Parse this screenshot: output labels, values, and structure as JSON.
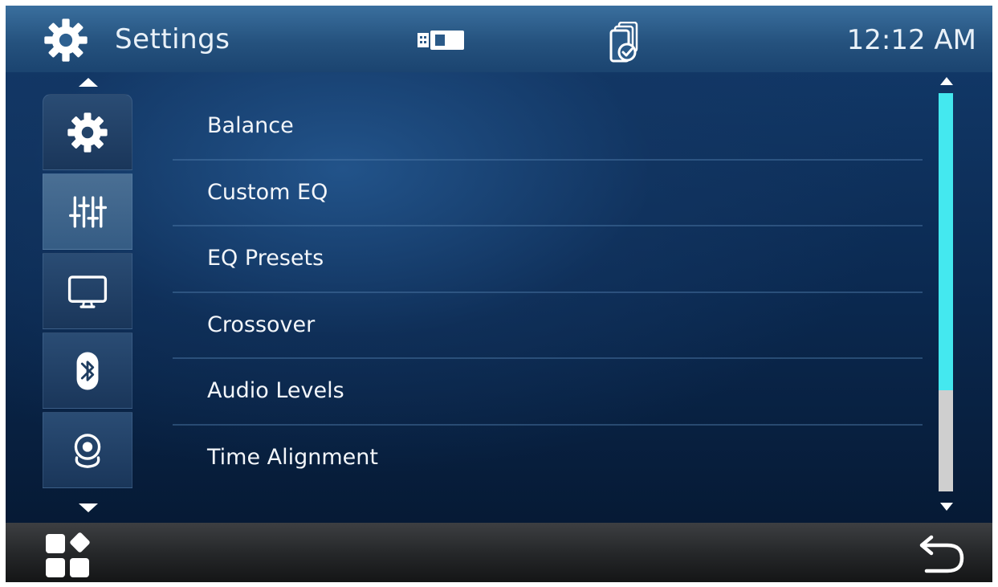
{
  "header": {
    "title": "Settings",
    "time": "12:12 AM",
    "icons": {
      "settings": "gear-icon",
      "storage": "usb-icon",
      "phone": "phone-connected-icon"
    }
  },
  "sidebar": {
    "items": [
      {
        "name": "general",
        "icon": "gear-icon",
        "active": false
      },
      {
        "name": "audio",
        "icon": "equalizer-sliders-icon",
        "active": true
      },
      {
        "name": "display",
        "icon": "monitor-icon",
        "active": false
      },
      {
        "name": "bluetooth",
        "icon": "bluetooth-icon",
        "active": false
      },
      {
        "name": "camera",
        "icon": "camera-icon",
        "active": false
      }
    ]
  },
  "menu": {
    "items": [
      {
        "label": "Balance"
      },
      {
        "label": "Custom EQ"
      },
      {
        "label": "EQ Presets"
      },
      {
        "label": "Crossover"
      },
      {
        "label": "Audio Levels"
      },
      {
        "label": "Time Alignment"
      }
    ]
  },
  "scrollbar": {
    "position_fraction": 0.0,
    "visible_fraction": 0.745
  },
  "footer": {
    "icons": {
      "apps": "apps-grid-icon",
      "back": "back-arrow-icon"
    }
  },
  "colors": {
    "accent": "#44e8ef",
    "header": "#2b5a88",
    "background": "#0c2748"
  }
}
